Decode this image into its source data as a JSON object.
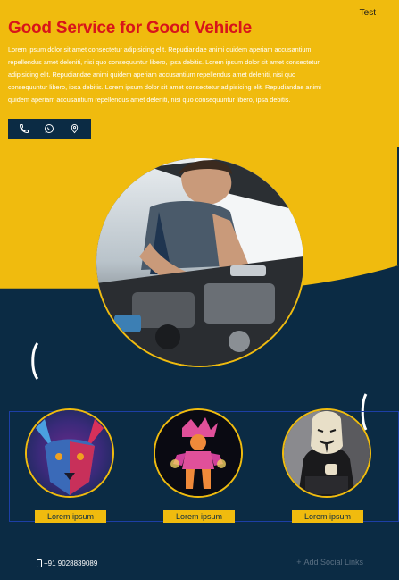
{
  "header": {
    "top_link": "Test"
  },
  "hero": {
    "title": "Good Service for Good Vehicle",
    "description": "Lorem ipsum dolor sit amet consectetur adipisicing elit. Repudiandae animi quidem aperiam accusantium repellendus amet deleniti, nisi quo consequuntur libero, ipsa debitis. Lorem ipsum dolor sit amet consectetur adipisicing elit. Repudiandae animi quidem aperiam accusantium repellendus amet deleniti, nisi quo consequuntur libero, ipsa debitis. Lorem ipsum dolor sit amet consectetur adipisicing elit. Repudiandae animi quidem aperiam accusantium repellendus amet deleniti, nisi quo consequuntur libero, ipsa debitis.",
    "contact_icons": [
      "phone-icon",
      "whatsapp-icon",
      "location-pin-icon"
    ],
    "image": "mechanic-repairing-car-engine"
  },
  "gallery": {
    "cards": [
      {
        "image": "wolf-portrait",
        "button_label": "Lorem ipsum"
      },
      {
        "image": "glowing-fighter-art",
        "button_label": "Lorem ipsum"
      },
      {
        "image": "masked-hacker",
        "button_label": "Lorem ipsum"
      }
    ]
  },
  "footer": {
    "phone": "+91 9028839089",
    "social_label": "Add Social Links"
  },
  "colors": {
    "accent": "#f0bb0e",
    "navy": "#0b2b44",
    "title_red": "#d8141a",
    "frame_blue": "#1d3fa6"
  }
}
